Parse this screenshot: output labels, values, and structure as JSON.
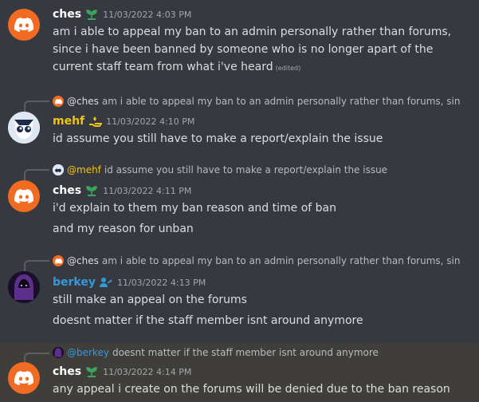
{
  "colors": {
    "ches": "#ffffff",
    "mehf": "#f1c40f",
    "berkey": "#3498db",
    "discord_orange": "#f26b22"
  },
  "messages": [
    {
      "author": "ches",
      "time": "11/03/2022 4:03 PM",
      "lines": [
        "am i able to appeal my ban to an admin personally rather than forums,",
        "since i have been banned by someone who is no longer apart of the",
        "current staff team from what i've heard"
      ],
      "edited": "(edited)"
    },
    {
      "reply_name": "@ches",
      "reply_text": "am i able to appeal my ban to an admin personally rather than forums, sin",
      "author": "mehf",
      "time": "11/03/2022 4:10 PM",
      "lines": [
        "id assume you still have to make a report/explain the issue"
      ]
    },
    {
      "reply_name": "@mehf",
      "reply_text": "id assume you still have to make a report/explain the issue",
      "author": "ches",
      "time": "11/03/2022 4:11 PM",
      "lines": [
        "i'd explain to them my ban reason and time of ban",
        "and my reason for unban"
      ]
    },
    {
      "reply_name": "@ches",
      "reply_text": "am i able to appeal my ban to an admin personally rather than forums, sin",
      "author": "berkey",
      "time": "11/03/2022 4:13 PM",
      "lines": [
        "still make an appeal on the forums",
        "doesnt matter if the staff member isnt around anymore"
      ]
    },
    {
      "reply_name": "@berkey",
      "reply_text": "doesnt matter if the staff member isnt around anymore",
      "author": "ches",
      "time": "11/03/2022 4:14 PM",
      "lines": [
        "any appeal i create on the forums will be denied due to the ban reason"
      ]
    }
  ]
}
